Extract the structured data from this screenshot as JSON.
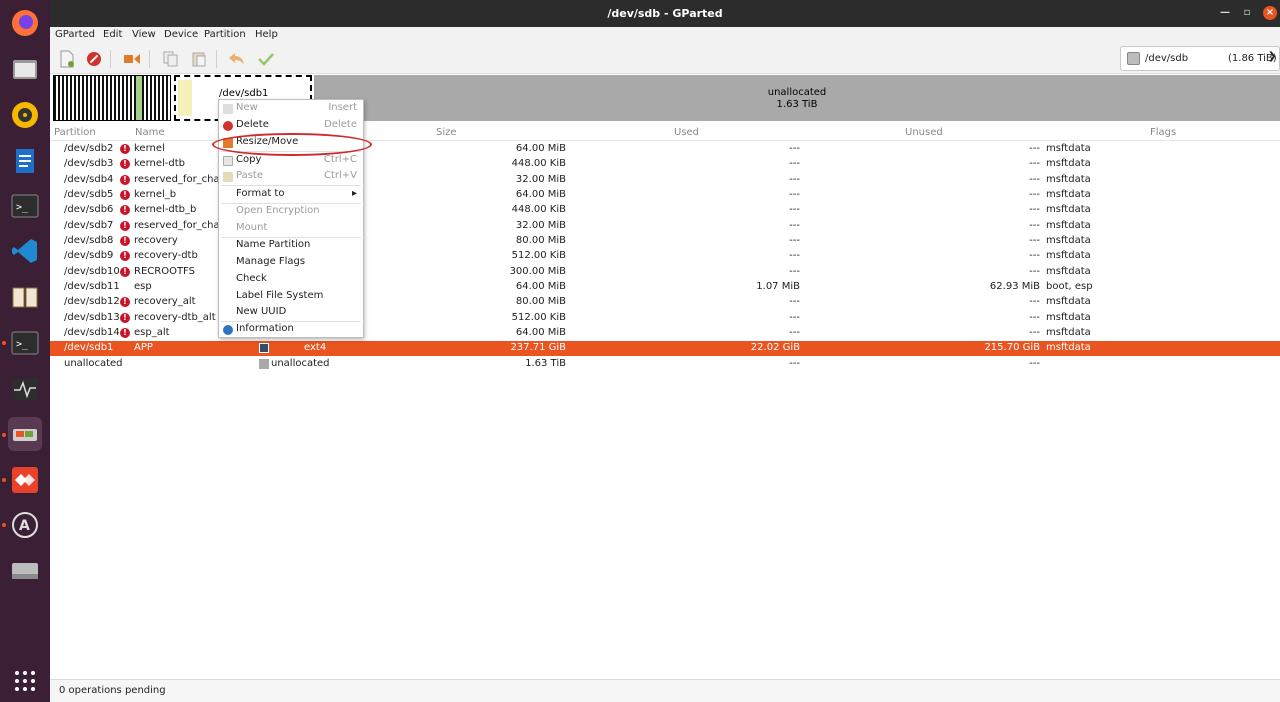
{
  "window": {
    "title": "/dev/sdb - GParted"
  },
  "menu": [
    "GParted",
    "Edit",
    "View",
    "Device",
    "Partition",
    "Help"
  ],
  "device": {
    "name": "/dev/sdb",
    "size": "(1.86 TiB)"
  },
  "graph": {
    "selected_label": "/dev/sdb1",
    "unallocated_label": "unallocated",
    "unallocated_size": "1.63 TiB"
  },
  "columns": [
    "Partition",
    "Name",
    "Size",
    "Used",
    "Unused",
    "Flags"
  ],
  "rows": [
    {
      "partition": "/dev/sdb2",
      "name": "kernel",
      "size": "64.00 MiB",
      "used": "---",
      "unused": "---",
      "flags": "msftdata",
      "warn": true
    },
    {
      "partition": "/dev/sdb3",
      "name": "kernel-dtb",
      "size": "448.00 KiB",
      "used": "---",
      "unused": "---",
      "flags": "msftdata",
      "warn": true
    },
    {
      "partition": "/dev/sdb4",
      "name": "reserved_for_chain",
      "size": "32.00 MiB",
      "used": "---",
      "unused": "---",
      "flags": "msftdata",
      "warn": true
    },
    {
      "partition": "/dev/sdb5",
      "name": "kernel_b",
      "size": "64.00 MiB",
      "used": "---",
      "unused": "---",
      "flags": "msftdata",
      "warn": true
    },
    {
      "partition": "/dev/sdb6",
      "name": "kernel-dtb_b",
      "size": "448.00 KiB",
      "used": "---",
      "unused": "---",
      "flags": "msftdata",
      "warn": true
    },
    {
      "partition": "/dev/sdb7",
      "name": "reserved_for_chain",
      "size": "32.00 MiB",
      "used": "---",
      "unused": "---",
      "flags": "msftdata",
      "warn": true
    },
    {
      "partition": "/dev/sdb8",
      "name": "recovery",
      "size": "80.00 MiB",
      "used": "---",
      "unused": "---",
      "flags": "msftdata",
      "warn": true
    },
    {
      "partition": "/dev/sdb9",
      "name": "recovery-dtb",
      "size": "512.00 KiB",
      "used": "---",
      "unused": "---",
      "flags": "msftdata",
      "warn": true
    },
    {
      "partition": "/dev/sdb10",
      "name": "RECROOTFS",
      "size": "300.00 MiB",
      "used": "---",
      "unused": "---",
      "flags": "msftdata",
      "warn": true
    },
    {
      "partition": "/dev/sdb11",
      "name": "esp",
      "size": "64.00 MiB",
      "used": "1.07 MiB",
      "unused": "62.93 MiB",
      "flags": "boot, esp",
      "warn": false
    },
    {
      "partition": "/dev/sdb12",
      "name": "recovery_alt",
      "size": "80.00 MiB",
      "used": "---",
      "unused": "---",
      "flags": "msftdata",
      "warn": true
    },
    {
      "partition": "/dev/sdb13",
      "name": "recovery-dtb_alt",
      "size": "512.00 KiB",
      "used": "---",
      "unused": "---",
      "flags": "msftdata",
      "warn": true
    },
    {
      "partition": "/dev/sdb14",
      "name": "esp_alt",
      "size": "64.00 MiB",
      "used": "---",
      "unused": "---",
      "flags": "msftdata",
      "warn": true
    },
    {
      "partition": "/dev/sdb1",
      "name": "APP",
      "fs": "ext4",
      "size": "237.71 GiB",
      "used": "22.02 GiB",
      "unused": "215.70 GiB",
      "flags": "msftdata",
      "warn": false,
      "selected": true
    },
    {
      "partition": "unallocated",
      "name": "",
      "fs": "unallocated",
      "size": "1.63 TiB",
      "used": "---",
      "unused": "---",
      "flags": "",
      "warn": false
    }
  ],
  "context_menu": [
    {
      "label": "New",
      "shortcut": "Insert",
      "disabled": true,
      "icon": "new-icon"
    },
    {
      "label": "Delete",
      "shortcut": "Delete",
      "disabled": false,
      "icon": "delete-icon"
    },
    {
      "label": "Resize/Move",
      "shortcut": "",
      "disabled": false,
      "icon": "resize-icon",
      "highlighted": true
    },
    {
      "label": "Copy",
      "shortcut": "Ctrl+C",
      "disabled": false,
      "icon": "copy-icon"
    },
    {
      "label": "Paste",
      "shortcut": "Ctrl+V",
      "disabled": true,
      "icon": "paste-icon"
    },
    {
      "label": "Format to",
      "shortcut": "▸",
      "disabled": false,
      "icon": ""
    },
    {
      "label": "Open Encryption",
      "shortcut": "",
      "disabled": true,
      "icon": ""
    },
    {
      "label": "Mount",
      "shortcut": "",
      "disabled": true,
      "icon": ""
    },
    {
      "label": "Name Partition",
      "shortcut": "",
      "disabled": false,
      "icon": ""
    },
    {
      "label": "Manage Flags",
      "shortcut": "",
      "disabled": false,
      "icon": ""
    },
    {
      "label": "Check",
      "shortcut": "",
      "disabled": false,
      "icon": ""
    },
    {
      "label": "Label File System",
      "shortcut": "",
      "disabled": false,
      "icon": ""
    },
    {
      "label": "New UUID",
      "shortcut": "",
      "disabled": false,
      "icon": ""
    },
    {
      "label": "Information",
      "shortcut": "",
      "disabled": false,
      "icon": "info-icon"
    }
  ],
  "status": {
    "text": "0 operations pending"
  },
  "colors": {
    "accent": "#e95420",
    "ext4": "#314e6c",
    "unallocated": "#a9a9a9",
    "dock": "#3b1f35"
  }
}
